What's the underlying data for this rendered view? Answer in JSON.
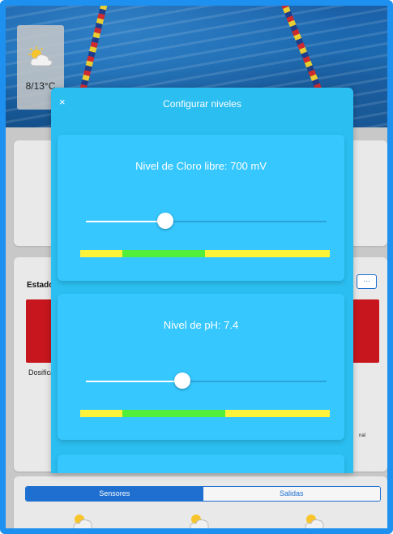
{
  "weather": {
    "temperature": "8/13°C",
    "icon": "partly-cloudy-icon"
  },
  "background": {
    "estado_label": "Estado",
    "dosific_label": "Dosifica",
    "nal_label": "nal",
    "more_label": "···"
  },
  "modal": {
    "close_label": "×",
    "title": "Configurar niveles",
    "levels": [
      {
        "label": "Nivel de Cloro libre: 700 mV",
        "slider_fraction": 0.33,
        "range": {
          "low_fraction": 0.17,
          "high_fraction": 0.5
        }
      },
      {
        "label": "Nivel de pH: 7.4",
        "slider_fraction": 0.4,
        "range": {
          "low_fraction": 0.17,
          "high_fraction": 0.58
        }
      }
    ]
  },
  "tabs": {
    "sensores": "Sensores",
    "salidas": "Salidas",
    "active": "Sensores"
  },
  "colors": {
    "accent": "#1e6fd0",
    "modal_bg": "#2bbef0",
    "card_bg": "#36c7ff",
    "range_ok": "#52ee3a",
    "range_warn": "#fff33a",
    "alarm_red": "#c7161d"
  }
}
